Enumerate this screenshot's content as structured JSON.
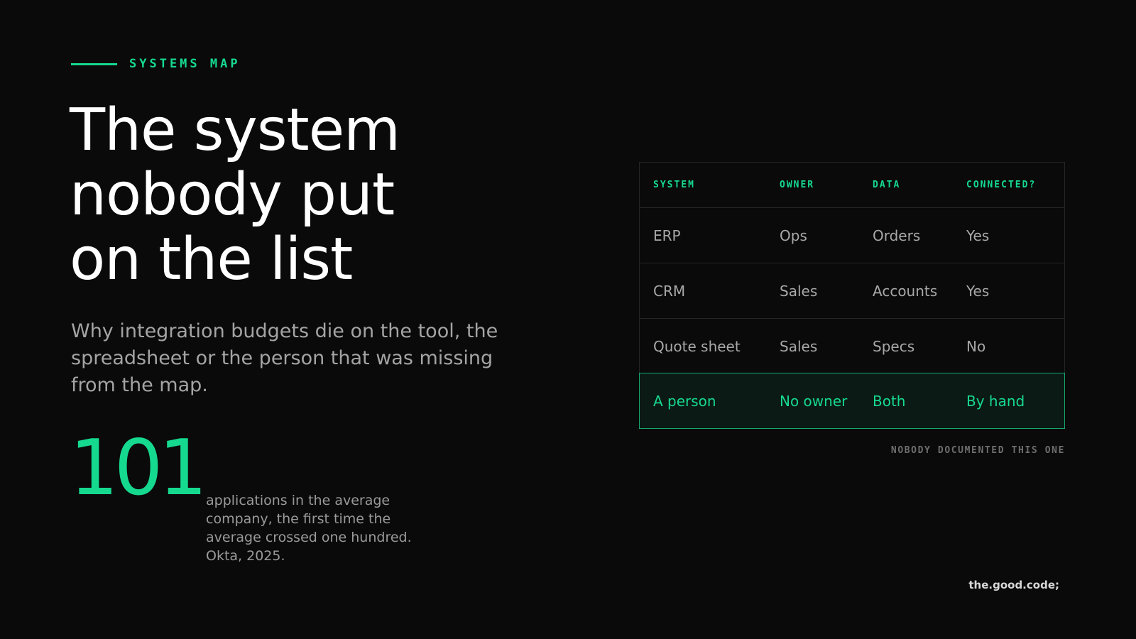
{
  "eyebrow": {
    "label": "SYSTEMS MAP"
  },
  "title": {
    "lines": [
      "The system",
      "nobody put",
      "on the list"
    ]
  },
  "subtitle": "Why integration budgets die on the tool, the spreadsheet or the person that was missing from the map.",
  "stat": {
    "number": "101",
    "description": "applications in the average company, the first time the average crossed one hundred. Okta, 2025."
  },
  "table": {
    "headers": [
      "SYSTEM",
      "OWNER",
      "DATA",
      "CONNECTED?"
    ],
    "rows": [
      [
        "ERP",
        "Ops",
        "Orders",
        "Yes"
      ],
      [
        "CRM",
        "Sales",
        "Accounts",
        "Yes"
      ],
      [
        "Quote sheet",
        "Sales",
        "Specs",
        "No"
      ],
      [
        "A person",
        "No owner",
        "Both",
        "By hand"
      ]
    ],
    "highlight_row_index": 3,
    "note": "NOBODY DOCUMENTED THIS ONE"
  },
  "brand": "the.good.code;",
  "colors": {
    "background": "#0a0a0a",
    "accent": "#16d990",
    "text_muted": "#a4a4a4"
  }
}
